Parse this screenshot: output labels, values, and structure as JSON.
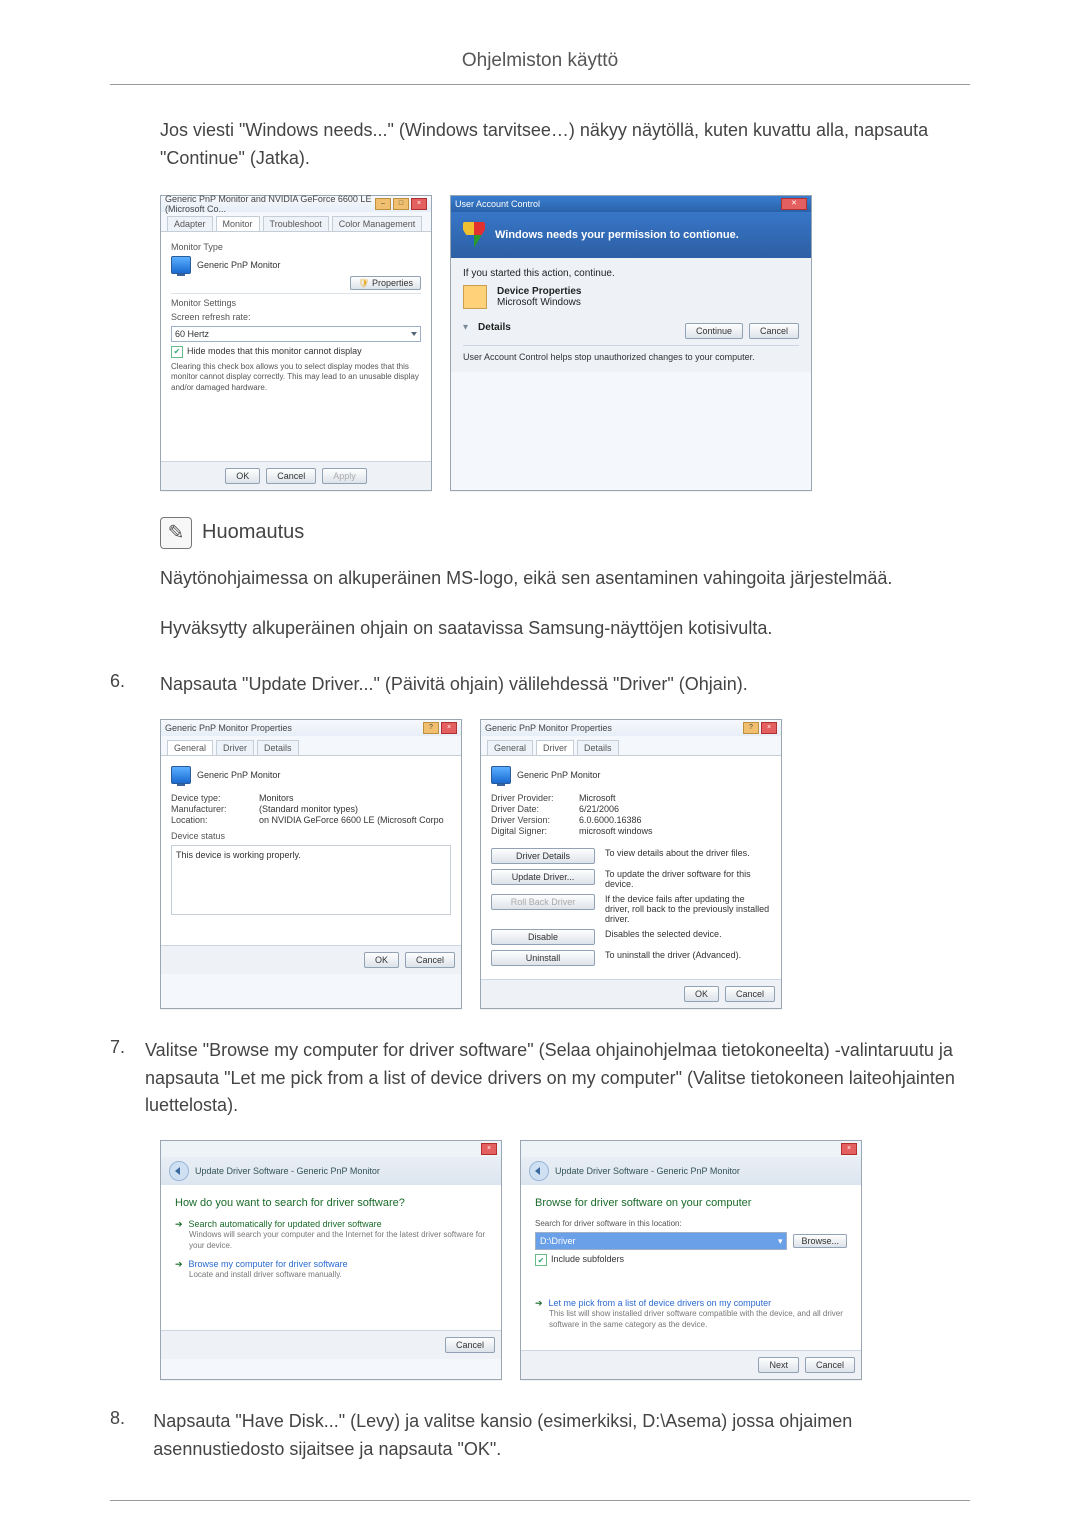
{
  "header": {
    "title": "Ohjelmiston käyttö"
  },
  "intro": {
    "p1": "Jos viesti \"Windows needs...\" (Windows tarvitsee…) näkyy näytöllä, kuten kuvattu alla, napsauta \"Continue\" (Jatka)."
  },
  "monitor_dlg": {
    "title": "Generic PnP Monitor and NVIDIA GeForce 6600 LE (Microsoft Co...",
    "tabs": {
      "adapter": "Adapter",
      "monitor": "Monitor",
      "troubleshoot": "Troubleshoot",
      "color": "Color Management"
    },
    "monitor_type_label": "Monitor Type",
    "monitor_type_value": "Generic PnP Monitor",
    "properties_btn": "Properties",
    "settings_label": "Monitor Settings",
    "refresh_label": "Screen refresh rate:",
    "refresh_value": "60 Hertz",
    "hide_modes_label": "Hide modes that this monitor cannot display",
    "hide_modes_note": "Clearing this check box allows you to select display modes that this monitor cannot display correctly. This may lead to an unusable display and/or damaged hardware.",
    "ok": "OK",
    "cancel": "Cancel",
    "apply": "Apply"
  },
  "uac": {
    "title": "User Account Control",
    "headline": "Windows needs your permission to contionue.",
    "started": "If you started this action, continue.",
    "item1": "Device Properties",
    "item2": "Microsoft Windows",
    "details": "Details",
    "continue": "Continue",
    "cancel": "Cancel",
    "footer": "User Account Control helps stop unauthorized changes to your computer."
  },
  "note": {
    "heading": "Huomautus",
    "p1": "Näytönohjaimessa on alkuperäinen MS-logo, eikä sen asentaminen vahingoita järjestelmää.",
    "p2": "Hyväksytty alkuperäinen ohjain on saatavissa Samsung-näyttöjen kotisivulta."
  },
  "step6": {
    "num": "6.",
    "text": "Napsauta \"Update Driver...\" (Päivitä ohjain) välilehdessä \"Driver\" (Ohjain)."
  },
  "prop_general": {
    "title": "Generic PnP Monitor Properties",
    "tabs": {
      "general": "General",
      "driver": "Driver",
      "details": "Details"
    },
    "name": "Generic PnP Monitor",
    "device_type_k": "Device type:",
    "device_type_v": "Monitors",
    "manufacturer_k": "Manufacturer:",
    "manufacturer_v": "(Standard monitor types)",
    "location_k": "Location:",
    "location_v": "on NVIDIA GeForce 6600 LE (Microsoft Corpo",
    "status_label": "Device status",
    "status_text": "This device is working properly.",
    "ok": "OK",
    "cancel": "Cancel"
  },
  "prop_driver": {
    "title": "Generic PnP Monitor Properties",
    "tabs": {
      "general": "General",
      "driver": "Driver",
      "details": "Details"
    },
    "name": "Generic PnP Monitor",
    "provider_k": "Driver Provider:",
    "provider_v": "Microsoft",
    "date_k": "Driver Date:",
    "date_v": "6/21/2006",
    "version_k": "Driver Version:",
    "version_v": "6.0.6000.16386",
    "signer_k": "Digital Signer:",
    "signer_v": "microsoft windows",
    "details_btn": "Driver Details",
    "details_desc": "To view details about the driver files.",
    "update_btn": "Update Driver...",
    "update_desc": "To update the driver software for this device.",
    "rollback_btn": "Roll Back Driver",
    "rollback_desc": "If the device fails after updating the driver, roll back to the previously installed driver.",
    "disable_btn": "Disable",
    "disable_desc": "Disables the selected device.",
    "uninstall_btn": "Uninstall",
    "uninstall_desc": "To uninstall the driver (Advanced).",
    "ok": "OK",
    "cancel": "Cancel"
  },
  "step7": {
    "num": "7.",
    "text": "Valitse \"Browse my computer for driver software\" (Selaa ohjainohjelmaa tietokoneelta) -valintaruutu ja napsauta \"Let me pick from a list of device drivers on my computer\" (Valitse tietokoneen laiteohjainten luettelosta)."
  },
  "wiz1": {
    "breadcrumb": "Update Driver Software - Generic PnP Monitor",
    "heading": "How do you want to search for driver software?",
    "opt1_title": "Search automatically for updated driver software",
    "opt1_sub": "Windows will search your computer and the Internet for the latest driver software for your device.",
    "opt2_title": "Browse my computer for driver software",
    "opt2_sub": "Locate and install driver software manually.",
    "cancel": "Cancel"
  },
  "wiz2": {
    "breadcrumb": "Update Driver Software - Generic PnP Monitor",
    "heading": "Browse for driver software on your computer",
    "search_label": "Search for driver software in this location:",
    "path_value": "D:\\Driver",
    "browse": "Browse...",
    "include_sub": "Include subfolders",
    "opt_title": "Let me pick from a list of device drivers on my computer",
    "opt_sub": "This list will show installed driver software compatible with the device, and all driver software in the same category as the device.",
    "next": "Next",
    "cancel": "Cancel"
  },
  "step8": {
    "num": "8.",
    "text": "Napsauta \"Have Disk...\" (Levy) ja valitse kansio (esimerkiksi, D:\\Asema) jossa ohjaimen asennustiedosto sijaitsee ja napsauta \"OK\"."
  }
}
